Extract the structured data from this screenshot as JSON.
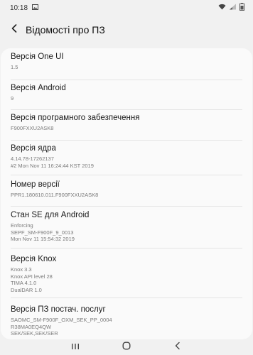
{
  "status_bar": {
    "time": "10:18",
    "icons": [
      "image-notification-icon",
      "wifi-icon",
      "signal-icon",
      "battery-icon"
    ]
  },
  "header": {
    "title": "Відомості про ПЗ",
    "back_icon": "back-arrow-icon"
  },
  "items": [
    {
      "title": "Версія One UI",
      "lines": [
        "1.5"
      ]
    },
    {
      "title": "Версія Android",
      "lines": [
        "9"
      ]
    },
    {
      "title": "Версія програмного забезпечення",
      "lines": [
        "F900FXXU2ASK8"
      ]
    },
    {
      "title": "Версія ядра",
      "lines": [
        "4.14.78-17262137",
        "#2 Mon Nov 11 16:24:44 KST 2019"
      ]
    },
    {
      "title": "Номер версії",
      "lines": [
        "PPR1.180610.011.F900FXXU2ASK8"
      ]
    },
    {
      "title": "Стан SE для Android",
      "lines": [
        "Enforcing",
        "SEPF_SM-F900F_9_0013",
        "Mon Nov 11 15:54:32 2019"
      ]
    },
    {
      "title": "Версія Knox",
      "lines": [
        "Knox 3.3",
        "Knox API level 28",
        "TIMA 4.1.0",
        "DualDAR 1.0"
      ]
    },
    {
      "title": "Версія ПЗ постач. послуг",
      "lines": [
        "SAOMC_SM-F900F_OXM_SEK_PP_0004",
        "R38MA0EQ4QW",
        "SEK/SEK,SEK/SER"
      ]
    }
  ],
  "nav_bar": {
    "icons": [
      "recent-apps-icon",
      "home-icon",
      "back-nav-icon"
    ]
  },
  "colors": {
    "background": "#f1f1f1",
    "card": "#fafafa",
    "title_text": "#1a1a1a",
    "secondary_text": "#7a7a7a"
  }
}
